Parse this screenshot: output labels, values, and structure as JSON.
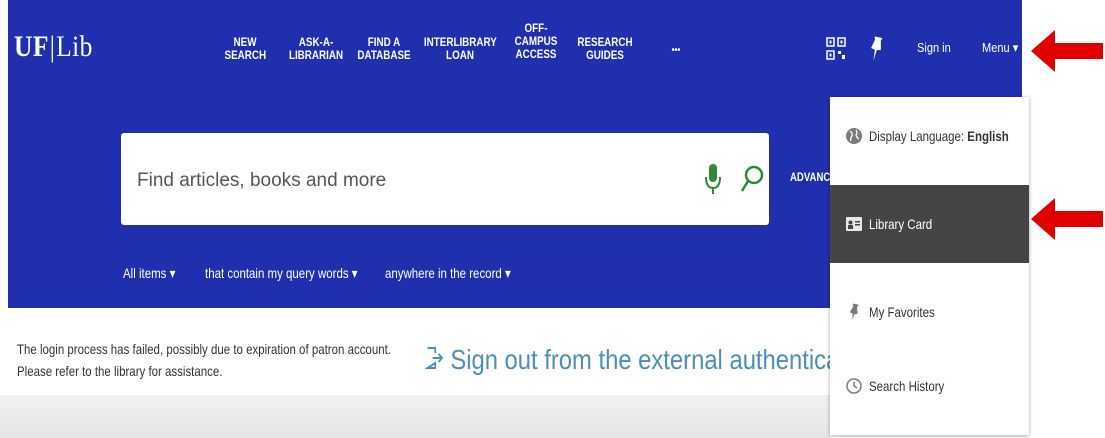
{
  "header": {
    "logo_uf": "UF",
    "logo_sep": "|",
    "logo_lib": "Lib",
    "nav": [
      {
        "line1": "NEW",
        "line2": "SEARCH",
        "line3": ""
      },
      {
        "line1": "ASK-A-",
        "line2": "LIBRARIAN",
        "line3": ""
      },
      {
        "line1": "FIND A",
        "line2": "DATABASE",
        "line3": ""
      },
      {
        "line1": "INTERLIBRARY",
        "line2": "LOAN",
        "line3": ""
      },
      {
        "line1": "OFF-",
        "line2": "CAMPUS",
        "line3": "ACCESS"
      },
      {
        "line1": "RESEARCH",
        "line2": "GUIDES",
        "line3": ""
      }
    ],
    "more": "•••",
    "sign_in": "Sign in",
    "menu": "Menu ▾"
  },
  "search": {
    "placeholder": "Find articles, books and more",
    "advanced": "ADVANCE",
    "filters": {
      "scope": "All items ▾",
      "operator": "that contain my query words ▾",
      "field": "anywhere in the record ▾"
    }
  },
  "message": {
    "error": "The login process has failed, possibly due to expiration of patron account. Please refer to the library for assistance.",
    "signout_icon": "➜",
    "signout": "Sign out from the external authenticatio"
  },
  "dropdown": {
    "language_label": "Display Language: ",
    "language_value": "English",
    "library_card": "Library Card",
    "favorites": "My Favorites",
    "history": "Search History"
  },
  "colors": {
    "header_bg": "#1f2fad",
    "active_item_bg": "#454545",
    "accent_green": "#2a8a3a",
    "signout_link": "#4a8fb5",
    "annotation_arrow": "#e00000"
  },
  "icons": [
    "qr-code-icon",
    "pin-icon",
    "microphone-icon",
    "search-icon",
    "globe-icon",
    "library-card-icon",
    "favorites-pin-icon",
    "history-icon",
    "sign-out-icon",
    "red-arrow-icon"
  ]
}
